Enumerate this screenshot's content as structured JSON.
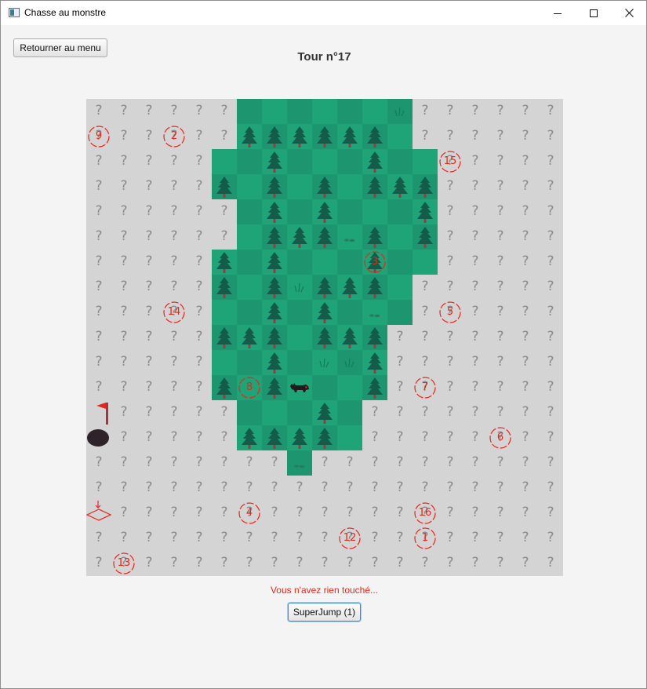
{
  "window": {
    "title": "Chasse au monstre",
    "controls": [
      "minimize",
      "maximize",
      "close"
    ]
  },
  "toolbar": {
    "back_label": "Retourner au menu"
  },
  "turn": {
    "label": "Tour n°17"
  },
  "board": {
    "cols": 19,
    "rows": 19,
    "revealed_rows": {
      "0": [
        6,
        12
      ],
      "1": [
        6,
        12
      ],
      "2": [
        5,
        13
      ],
      "3": [
        5,
        13
      ],
      "4": [
        6,
        13
      ],
      "5": [
        6,
        13
      ],
      "6": [
        5,
        13
      ],
      "7": [
        5,
        12
      ],
      "8": [
        5,
        12
      ],
      "9": [
        5,
        11
      ],
      "10": [
        5,
        11
      ],
      "11": [
        5,
        11
      ],
      "12": [
        6,
        10
      ],
      "13": [
        6,
        10
      ],
      "14": [
        8,
        8
      ]
    },
    "trees": [
      [
        1,
        6
      ],
      [
        1,
        7
      ],
      [
        1,
        8
      ],
      [
        1,
        9
      ],
      [
        1,
        10
      ],
      [
        1,
        11
      ],
      [
        2,
        7
      ],
      [
        2,
        11
      ],
      [
        3,
        5
      ],
      [
        3,
        7
      ],
      [
        3,
        9
      ],
      [
        3,
        11
      ],
      [
        3,
        12
      ],
      [
        3,
        13
      ],
      [
        4,
        7
      ],
      [
        4,
        9
      ],
      [
        4,
        13
      ],
      [
        5,
        7
      ],
      [
        5,
        8
      ],
      [
        5,
        9
      ],
      [
        5,
        11
      ],
      [
        5,
        13
      ],
      [
        6,
        5
      ],
      [
        6,
        7
      ],
      [
        6,
        11
      ],
      [
        7,
        5
      ],
      [
        7,
        7
      ],
      [
        7,
        9
      ],
      [
        7,
        10
      ],
      [
        7,
        11
      ],
      [
        8,
        7
      ],
      [
        8,
        9
      ],
      [
        9,
        5
      ],
      [
        9,
        6
      ],
      [
        9,
        7
      ],
      [
        9,
        9
      ],
      [
        9,
        10
      ],
      [
        9,
        11
      ],
      [
        10,
        7
      ],
      [
        10,
        11
      ],
      [
        11,
        5
      ],
      [
        11,
        7
      ],
      [
        11,
        11
      ],
      [
        12,
        9
      ],
      [
        13,
        6
      ],
      [
        13,
        7
      ],
      [
        13,
        8
      ],
      [
        13,
        9
      ]
    ],
    "grass_tufts": [
      [
        0,
        12
      ],
      [
        7,
        8
      ],
      [
        10,
        9
      ],
      [
        10,
        10
      ]
    ],
    "rocks": [
      [
        5,
        10
      ],
      [
        8,
        11
      ],
      [
        14,
        8
      ]
    ],
    "monster": [
      11,
      8
    ],
    "markers": [
      {
        "label": "9",
        "row": 1,
        "col": 0
      },
      {
        "label": "2",
        "row": 1,
        "col": 3
      },
      {
        "label": "15",
        "row": 2,
        "col": 14
      },
      {
        "label": "3",
        "row": 6,
        "col": 11
      },
      {
        "label": "14",
        "row": 8,
        "col": 3
      },
      {
        "label": "5",
        "row": 8,
        "col": 14
      },
      {
        "label": "8",
        "row": 11,
        "col": 6
      },
      {
        "label": "7",
        "row": 11,
        "col": 13
      },
      {
        "label": "6",
        "row": 13,
        "col": 16
      },
      {
        "label": "4",
        "row": 16,
        "col": 6
      },
      {
        "label": "16",
        "row": 16,
        "col": 13
      },
      {
        "label": "12",
        "row": 17,
        "col": 10
      },
      {
        "label": "1",
        "row": 17,
        "col": 13
      },
      {
        "label": "13",
        "row": 18,
        "col": 1
      }
    ],
    "flag": [
      12,
      0
    ],
    "hole": [
      13,
      0
    ],
    "start_marker": [
      16,
      0
    ],
    "colors": {
      "unknown": "#d4d4d4",
      "grass": "#1fa477",
      "grass_dark": "#1d9670",
      "tree": "#135c49",
      "trunk": "#a23544",
      "marker": "#e4271b",
      "monster": "#241a1e"
    }
  },
  "status": {
    "message": "Vous n'avez rien touché..."
  },
  "actions": {
    "superjump_label": "SuperJump (1)"
  }
}
